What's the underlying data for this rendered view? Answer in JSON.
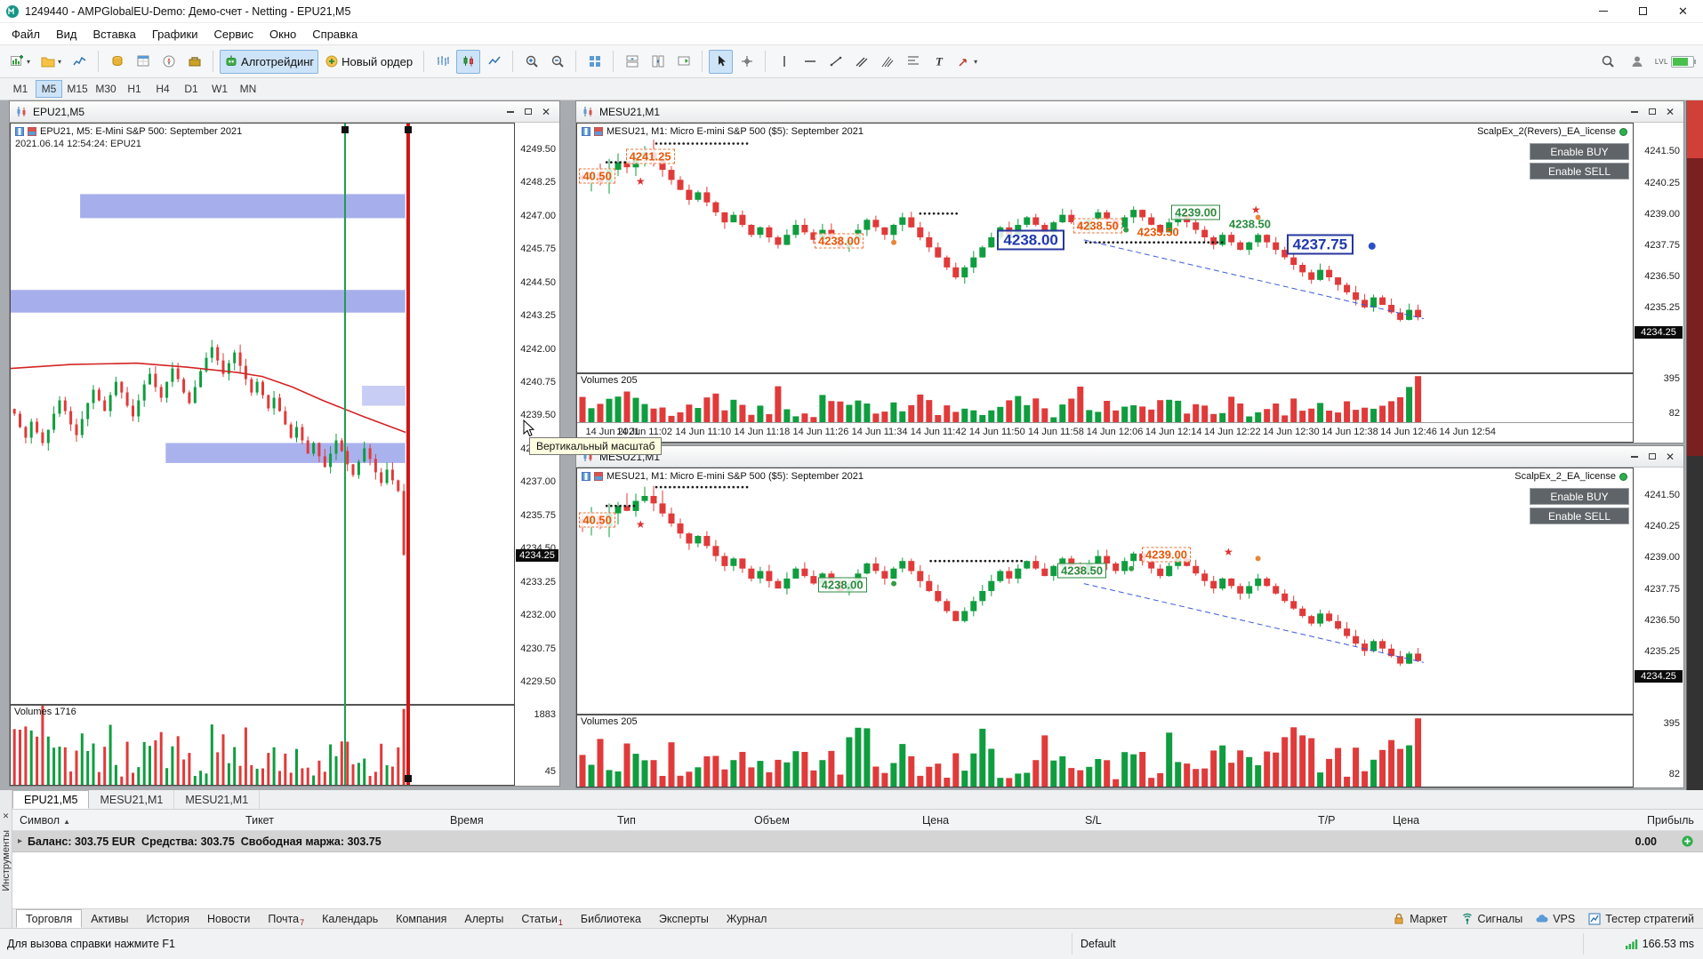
{
  "window": {
    "title": "1249440 - AMPGlobalEU-Demo: Демо-счет - Netting - EPU21,M5"
  },
  "menu": {
    "items": [
      "Файл",
      "Вид",
      "Вставка",
      "Графики",
      "Сервис",
      "Окно",
      "Справка"
    ]
  },
  "toolbar": {
    "algo_trading": "Алготрейдинг",
    "new_order": "Новый ордер",
    "lvl_label": "LVL"
  },
  "timeframes": {
    "items": [
      "M1",
      "M5",
      "M15",
      "M30",
      "H1",
      "H4",
      "D1",
      "W1",
      "MN"
    ],
    "active": "M5"
  },
  "tooltip": {
    "text": "Вертикальный масштаб"
  },
  "chart_tabs": {
    "items": [
      "EPU21,M5",
      "MESU21,M1",
      "MESU21,M1"
    ],
    "active_index": 0
  },
  "toolbox": {
    "dock_label": "Инструменты",
    "columns": [
      "Символ",
      "Тикет",
      "Время",
      "Тип",
      "Объем",
      "Цена",
      "S/L",
      "T/P",
      "Цена",
      "Прибыль"
    ],
    "balance_text": "Баланс: 303.75 EUR  Средства: 303.75  Свободная маржа: 303.75",
    "profit_total": "0.00",
    "tabs": [
      {
        "label": "Торговля",
        "active": true
      },
      {
        "label": "Активы"
      },
      {
        "label": "История"
      },
      {
        "label": "Новости"
      },
      {
        "label": "Почта",
        "badge": "7"
      },
      {
        "label": "Календарь"
      },
      {
        "label": "Компания"
      },
      {
        "label": "Алерты"
      },
      {
        "label": "Статьи",
        "badge": "1"
      },
      {
        "label": "Библиотека"
      },
      {
        "label": "Эксперты"
      },
      {
        "label": "Журнал"
      }
    ],
    "corner_buttons": [
      "Маркет",
      "Сигналы",
      "VPS",
      "Тестер стратегий"
    ]
  },
  "status_bar": {
    "help": "Для вызова справки нажмите F1",
    "profile": "Default",
    "latency": "166.53 ms"
  },
  "charts": {
    "left": {
      "title": "EPU21,M5",
      "info_line": "EPU21, M5: E-Mini S&P 500: September 2021",
      "date_line": "2021.06.14 12:54:24: EPU21",
      "volumes_label": "Volumes 1716",
      "price_ticks": [
        "4249.50",
        "4248.25",
        "4247.00",
        "4245.75",
        "4244.50",
        "4243.25",
        "4242.00",
        "4240.75",
        "4239.50",
        "4238.25",
        "4237.00",
        "4235.75",
        "4234.50",
        "4233.25",
        "4232.00",
        "4230.75",
        "4229.50"
      ],
      "price_tag": "4234.25",
      "vol_ticks": [
        "1883",
        "45"
      ],
      "zones": [
        {
          "x1": 0.138,
          "x2": 0.784,
          "p1": 4247.85,
          "p2": 4246.95,
          "color": "#a6aeeb"
        },
        {
          "x1": 0.0,
          "x2": 0.784,
          "p1": 4244.25,
          "p2": 4243.4,
          "color": "#a6aeeb"
        },
        {
          "x1": 0.698,
          "x2": 0.784,
          "p1": 4240.65,
          "p2": 4239.9,
          "color": "#c7cdf5"
        },
        {
          "x1": 0.308,
          "x2": 0.784,
          "p1": 4238.5,
          "p2": 4237.75,
          "color": "#aab2ee"
        }
      ],
      "vlines": [
        {
          "x": 0.664,
          "w": 2,
          "color": "#1e9e50"
        },
        {
          "x": 0.789,
          "w": 4,
          "color": "#cf1616"
        }
      ],
      "ma": [
        [
          0.0,
          4241.3
        ],
        [
          0.12,
          4241.45
        ],
        [
          0.25,
          4241.5
        ],
        [
          0.35,
          4241.35
        ],
        [
          0.45,
          4241.15
        ],
        [
          0.5,
          4241.0
        ],
        [
          0.56,
          4240.6
        ],
        [
          0.62,
          4240.1
        ],
        [
          0.7,
          4239.5
        ],
        [
          0.785,
          4238.9
        ]
      ]
    },
    "right_top": {
      "title": "MESU21,M1",
      "info_line": "MESU21, M1: Micro E-mini S&P 500 ($5): September 2021",
      "license": "ScalpEx_2(Revers)_EA_license",
      "enable_buy": "Enable BUY",
      "enable_sell": "Enable SELL",
      "volumes_label": "Volumes 205",
      "price_ticks": [
        "4241.50",
        "4240.25",
        "4239.00",
        "4237.75",
        "4236.50",
        "4235.25"
      ],
      "price_tag": "4234.25",
      "vol_ticks": [
        "395",
        "82"
      ],
      "time_labels": [
        "14 Jun 2021",
        "14 Jun 11:02",
        "14 Jun 11:10",
        "14 Jun 11:18",
        "14 Jun 11:26",
        "14 Jun 11:34",
        "14 Jun 11:42",
        "14 Jun 11:50",
        "14 Jun 11:58",
        "14 Jun 12:06",
        "14 Jun 12:14",
        "14 Jun 12:22",
        "14 Jun 12:30",
        "14 Jun 12:38",
        "14 Jun 12:46",
        "14 Jun 12:54"
      ],
      "labels": [
        {
          "text": "40.50",
          "x": 0.002,
          "price": 4240.55,
          "style": "orange-dashed"
        },
        {
          "text": "4241.25",
          "x": 0.046,
          "price": 4241.35,
          "style": "orange-dashed"
        },
        {
          "text": "4238.00",
          "x": 0.225,
          "price": 4237.95,
          "style": "orange-dashed"
        },
        {
          "text": "4238.00",
          "x": 0.398,
          "price": 4238.0,
          "style": "blue-box"
        },
        {
          "text": "4238.50",
          "x": 0.47,
          "price": 4238.55,
          "style": "orange-dashed"
        },
        {
          "text": "4235.50",
          "x": 0.528,
          "price": 4238.3,
          "style": "orange-plain"
        },
        {
          "text": "4239.00",
          "x": 0.563,
          "price": 4239.1,
          "style": "green-box"
        },
        {
          "text": "4238.50",
          "x": 0.615,
          "price": 4238.65,
          "style": "green-plain"
        },
        {
          "text": "4237.75",
          "x": 0.672,
          "price": 4237.8,
          "style": "blue-box"
        }
      ],
      "stars": [
        {
          "x": 0.06,
          "price": 4240.35
        },
        {
          "x": 0.643,
          "price": 4239.2
        }
      ],
      "dots": [
        [
          0.028,
          0.055,
          4241.1
        ],
        [
          0.075,
          0.165,
          4241.85
        ],
        [
          0.325,
          0.362,
          4239.05
        ],
        [
          0.482,
          0.615,
          4237.9
        ]
      ],
      "trend": [
        0.48,
        4238.0,
        0.802,
        4234.85
      ],
      "blue_dot": [
        0.753,
        4237.75
      ],
      "markers": [
        {
          "x": 0.3,
          "price": 4237.9,
          "c": "#e8863a"
        },
        {
          "x": 0.41,
          "price": 4238.15,
          "c": "#2f9e44"
        },
        {
          "x": 0.52,
          "price": 4238.4,
          "c": "#2f9e44"
        },
        {
          "x": 0.6,
          "price": 4239.2,
          "c": "#e8863a"
        },
        {
          "x": 0.645,
          "price": 4238.9,
          "c": "#e8863a"
        }
      ]
    },
    "right_bottom": {
      "title": "MESU21,M1",
      "info_line": "MESU21, M1: Micro E-mini S&P 500 ($5): September 2021",
      "license": "ScalpEx_2_EA_license",
      "enable_buy": "Enable BUY",
      "enable_sell": "Enable SELL",
      "volumes_label": "Volumes 205",
      "price_ticks": [
        "4241.50",
        "4240.25",
        "4239.00",
        "4237.75",
        "4236.50",
        "4235.25"
      ],
      "price_tag": "4234.25",
      "vol_ticks": [
        "395",
        "82"
      ],
      "labels": [
        {
          "text": "40.50",
          "x": 0.002,
          "price": 4240.55,
          "style": "orange-dashed"
        },
        {
          "text": "4238.00",
          "x": 0.228,
          "price": 4237.95,
          "style": "green-box"
        },
        {
          "text": "4238.50",
          "x": 0.455,
          "price": 4238.5,
          "style": "green-box"
        },
        {
          "text": "4239.00",
          "x": 0.535,
          "price": 4239.15,
          "style": "orange-dashed"
        }
      ],
      "stars": [
        {
          "x": 0.06,
          "price": 4240.35
        },
        {
          "x": 0.617,
          "price": 4239.25
        }
      ],
      "dots": [
        [
          0.028,
          0.055,
          4241.1
        ],
        [
          0.075,
          0.165,
          4241.85
        ],
        [
          0.335,
          0.425,
          4238.9
        ]
      ],
      "trend": [
        0.48,
        4238.0,
        0.802,
        4234.85
      ],
      "markers": [
        {
          "x": 0.3,
          "price": 4238.0,
          "c": "#2f9e44"
        },
        {
          "x": 0.525,
          "price": 4238.6,
          "c": "#2f9e44"
        },
        {
          "x": 0.645,
          "price": 4239.0,
          "c": "#e8863a"
        }
      ]
    }
  },
  "chart_data": [
    {
      "id": "left",
      "type": "candlestick",
      "symbol": "EPU21",
      "timeframe": "M5",
      "price_top": 4250.5,
      "price_bottom": 4228.7,
      "x_end": 0.785,
      "amp": 0.3,
      "last_spike": true,
      "left_spike": true,
      "seed": 11,
      "closes": [
        4239.6,
        4239.1,
        4238.7,
        4239.3,
        4238.9,
        4238.5,
        4239.0,
        4239.6,
        4240.1,
        4239.7,
        4239.2,
        4238.8,
        4239.4,
        4240.0,
        4240.5,
        4240.1,
        4239.7,
        4240.3,
        4240.8,
        4240.4,
        4239.9,
        4239.5,
        4240.1,
        4240.7,
        4241.1,
        4240.6,
        4240.2,
        4240.8,
        4241.3,
        4240.9,
        4240.4,
        4240.0,
        4240.6,
        4241.2,
        4241.7,
        4242.1,
        4241.6,
        4241.1,
        4241.5,
        4241.9,
        4241.4,
        4240.9,
        4240.4,
        4240.8,
        4240.3,
        4239.8,
        4240.2,
        4239.7,
        4239.2,
        4238.7,
        4239.1,
        4238.6,
        4238.1,
        4238.5,
        4238.0,
        4237.6,
        4238.1,
        4238.6,
        4238.2,
        4237.7,
        4237.3,
        4237.8,
        4238.3,
        4237.9,
        4237.4,
        4237.0,
        4237.5,
        4237.1,
        4236.7,
        4234.3
      ]
    },
    {
      "id": "right_top",
      "type": "candlestick",
      "symbol": "MESU21",
      "timeframe": "M1",
      "price_top": 4242.65,
      "price_bottom": 4232.7,
      "x_end": 0.8,
      "amp": 0.26,
      "wild_start": true,
      "last_spike": true,
      "seed": 23,
      "closes": [
        4240.4,
        4240.7,
        4240.3,
        4240.8,
        4241.1,
        4240.9,
        4241.3,
        4241.5,
        4241.2,
        4240.8,
        4240.4,
        4240.0,
        4239.6,
        4239.9,
        4239.5,
        4239.1,
        4238.7,
        4239.0,
        4238.6,
        4238.2,
        4238.5,
        4238.1,
        4237.8,
        4238.2,
        4238.6,
        4238.3,
        4238.0,
        4238.4,
        4238.1,
        4237.7,
        4238.0,
        4238.4,
        4238.8,
        4238.5,
        4238.2,
        4238.6,
        4238.9,
        4238.5,
        4238.1,
        4237.7,
        4237.3,
        4236.9,
        4236.5,
        4236.9,
        4237.3,
        4237.7,
        4238.1,
        4238.5,
        4238.2,
        4238.6,
        4238.9,
        4238.6,
        4238.3,
        4238.7,
        4239.0,
        4238.7,
        4238.4,
        4238.8,
        4239.1,
        4238.8,
        4238.5,
        4238.9,
        4239.2,
        4238.9,
        4238.6,
        4238.3,
        4238.7,
        4239.0,
        4238.7,
        4238.4,
        4238.1,
        4237.8,
        4238.2,
        4237.9,
        4237.6,
        4237.9,
        4238.2,
        4237.9,
        4237.6,
        4237.3,
        4237.0,
        4236.7,
        4236.4,
        4236.8,
        4236.5,
        4236.2,
        4235.9,
        4235.6,
        4235.3,
        4235.7,
        4235.4,
        4235.1,
        4234.8,
        4235.2,
        4234.9
      ]
    },
    {
      "id": "right_bottom",
      "type": "candlestick",
      "symbol": "MESU21",
      "timeframe": "M1",
      "price_top": 4242.6,
      "price_bottom": 4232.8,
      "x_end": 0.8,
      "amp": 0.26,
      "wild_start": true,
      "last_spike": true,
      "seed": 31,
      "closes": [
        4240.4,
        4240.7,
        4240.3,
        4240.8,
        4241.1,
        4240.9,
        4241.3,
        4241.5,
        4241.2,
        4240.8,
        4240.4,
        4240.0,
        4239.6,
        4239.9,
        4239.5,
        4239.1,
        4238.7,
        4239.0,
        4238.6,
        4238.2,
        4238.5,
        4238.1,
        4237.8,
        4238.2,
        4238.6,
        4238.3,
        4238.0,
        4238.4,
        4238.1,
        4237.7,
        4238.0,
        4238.4,
        4238.8,
        4238.5,
        4238.2,
        4238.6,
        4238.9,
        4238.5,
        4238.1,
        4237.7,
        4237.3,
        4236.9,
        4236.5,
        4236.9,
        4237.3,
        4237.7,
        4238.1,
        4238.5,
        4238.2,
        4238.6,
        4238.9,
        4238.6,
        4238.3,
        4238.7,
        4239.0,
        4238.7,
        4238.4,
        4238.8,
        4239.1,
        4238.8,
        4238.5,
        4238.9,
        4239.2,
        4238.9,
        4238.6,
        4238.3,
        4238.7,
        4239.0,
        4238.7,
        4238.4,
        4238.1,
        4237.8,
        4238.2,
        4237.9,
        4237.6,
        4237.9,
        4238.2,
        4237.9,
        4237.6,
        4237.3,
        4237.0,
        4236.7,
        4236.4,
        4236.8,
        4236.5,
        4236.2,
        4235.9,
        4235.6,
        4235.3,
        4235.7,
        4235.4,
        4235.1,
        4234.8,
        4235.2,
        4234.9
      ]
    }
  ]
}
